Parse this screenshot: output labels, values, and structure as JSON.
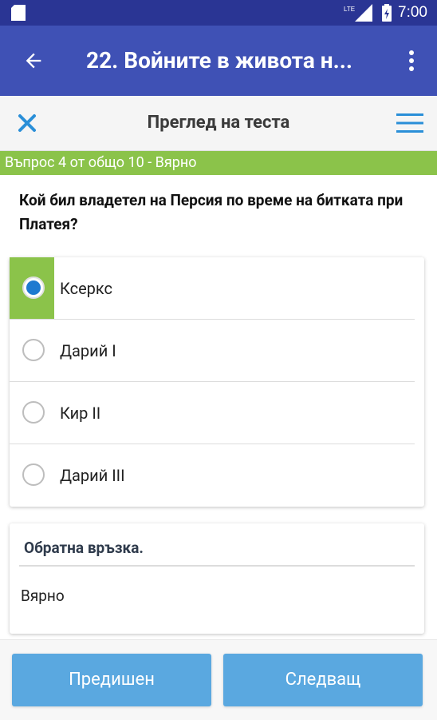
{
  "status_bar": {
    "time": "7:00",
    "network": "LTE",
    "icons": [
      "sd-card-icon",
      "signal-icon",
      "battery-icon"
    ]
  },
  "app_bar": {
    "title": "22. Войните в живота н...",
    "back_icon": "arrow-left-icon",
    "more_icon": "more-vert-icon"
  },
  "sub_bar": {
    "title": "Преглед на теста",
    "close_icon": "close-icon",
    "menu_icon": "menu-icon"
  },
  "progress": {
    "text": "Въпрос 4 от общо 10 - Вярно"
  },
  "question": {
    "text": "Кой бил владетел на Персия по време на битката при Платея?"
  },
  "answers": [
    {
      "label": "Ксеркс",
      "selected": true,
      "correct": true
    },
    {
      "label": "Дарий I",
      "selected": false
    },
    {
      "label": "Кир II",
      "selected": false
    },
    {
      "label": "Дарий III",
      "selected": false
    }
  ],
  "feedback": {
    "title": "Обратна връзка.",
    "text": "Вярно"
  },
  "buttons": {
    "prev": "Предишен",
    "next": "Следващ"
  },
  "colors": {
    "status_bar": "#2a3594",
    "app_bar": "#3f51b5",
    "correct_green": "#8bc34a",
    "accent_blue": "#1e7ad0",
    "button_blue": "#5aa8e0"
  }
}
